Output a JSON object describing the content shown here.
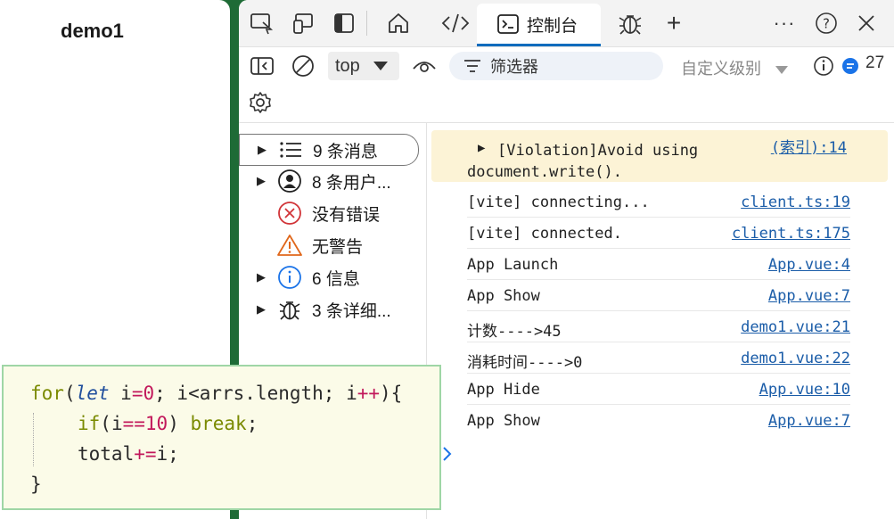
{
  "left": {
    "title": "demo1"
  },
  "tabs": {
    "console_label": "控制台"
  },
  "toolbar": {
    "context": "top",
    "filter_placeholder": "筛选器",
    "levels_label": "自定义级别",
    "issues_count": "27"
  },
  "sidebar": {
    "items": [
      {
        "label": "9 条消息"
      },
      {
        "label": "8 条用户..."
      },
      {
        "label": "没有错误"
      },
      {
        "label": "无警告"
      },
      {
        "label": "6 信息"
      },
      {
        "label": "3 条详细..."
      }
    ]
  },
  "console": {
    "rows": [
      {
        "msg": "[Violation]Avoid using",
        "msg2": "document.write().",
        "src": "(索引):14"
      },
      {
        "msg": "[vite] connecting...",
        "src": "client.ts:19"
      },
      {
        "msg": "[vite] connected.",
        "src": "client.ts:175"
      },
      {
        "msg": "App Launch",
        "src": "App.vue:4"
      },
      {
        "msg": "App Show",
        "src": "App.vue:7"
      },
      {
        "msg": "计数---->45",
        "src": "demo1.vue:21"
      },
      {
        "msg": "消耗时间---->0",
        "src": "demo1.vue:22"
      },
      {
        "msg": "App Hide",
        "src": "App.vue:10"
      },
      {
        "msg": "App Show",
        "src": "App.vue:7"
      }
    ]
  },
  "code": {
    "line1": {
      "for": "for",
      "paren_open": "(",
      "let": "let",
      "init": " i",
      "eq": "=",
      "zero": "0",
      "rest": "; i<arrs.length; i",
      "inc": "++",
      "close": "){"
    },
    "line2": {
      "if": "if",
      "open": "(i",
      "eqeq": "==",
      "ten": "10",
      "close": ") ",
      "break": "break",
      "semi": ";"
    },
    "line3": {
      "a": "total",
      "op": "+=",
      "b": "i;"
    },
    "line4": "}"
  }
}
